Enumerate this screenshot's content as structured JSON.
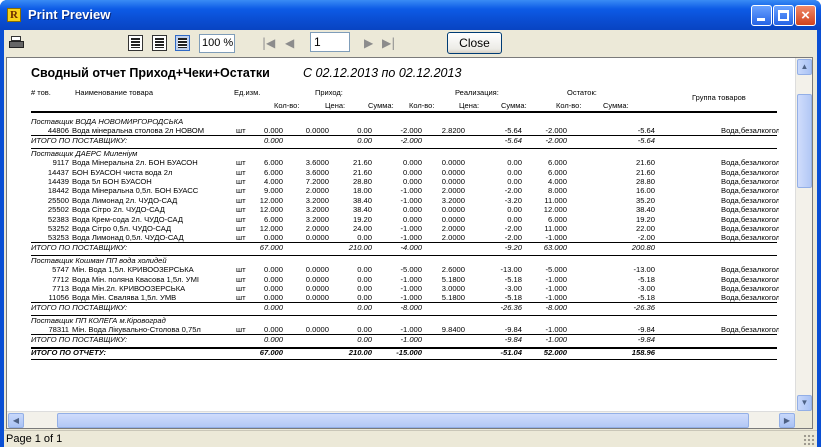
{
  "window": {
    "title": "Print Preview",
    "icon_letter": "R"
  },
  "toolbar": {
    "zoom": "100 %",
    "page": "1",
    "close_label": "Close"
  },
  "report": {
    "title": "Сводный отчет Приход+Чеки+Остатки",
    "period": "С 02.12.2013 по 02.12.2013",
    "headers": {
      "num": "# тов.",
      "name": "Наименование товара",
      "unit": "Ед.изм.",
      "income": "Приход:",
      "sales": "Реализация:",
      "rest": "Остаток:",
      "group": "Группа товаров",
      "qty": "Кол-во:",
      "price": "Цена:",
      "sum": "Сумма:"
    },
    "rows": [
      {
        "type": "supplier",
        "label": "Поставщик  ВОДА НОВОМИРГОРОДСЬКА"
      },
      {
        "type": "item",
        "code": "44806",
        "name": "Вода мінеральна столова 2л НОВОМ",
        "unit": "шт",
        "q1": "0.000",
        "p1": "0.0000",
        "s1": "0.00",
        "q2": "-2.000",
        "p2": "2.8200",
        "s2": "-5.64",
        "q3": "-2.000",
        "s3": "-5.64",
        "group": "Вода,безалкогольні напої"
      },
      {
        "type": "total",
        "label": "ИТОГО ПО ПОСТАВЩИКУ:",
        "q1": "0.000",
        "s1": "0.00",
        "q2": "-2.000",
        "s2": "-5.64",
        "q3": "-2.000",
        "s3": "-5.64"
      },
      {
        "type": "supplier",
        "label": "Поставщик  ДАЕРС Миленіум"
      },
      {
        "type": "item",
        "code": "9117",
        "name": "Вода Мінеральна  2л. БОН БУАСОН",
        "unit": "шт",
        "q1": "6.000",
        "p1": "3.6000",
        "s1": "21.60",
        "q2": "0.000",
        "p2": "0.0000",
        "s2": "0.00",
        "q3": "6.000",
        "s3": "21.60",
        "group": "Вода,безалкогольні напої"
      },
      {
        "type": "item",
        "code": "14437",
        "name": "БОН БУАСОН чиста вода 2л",
        "unit": "шт",
        "q1": "6.000",
        "p1": "3.6000",
        "s1": "21.60",
        "q2": "0.000",
        "p2": "0.0000",
        "s2": "0.00",
        "q3": "6.000",
        "s3": "21.60",
        "group": "Вода,безалкогольні напої"
      },
      {
        "type": "item",
        "code": "14439",
        "name": "Вода 5л БОН БУАСОН",
        "unit": "шт",
        "q1": "4.000",
        "p1": "7.2000",
        "s1": "28.80",
        "q2": "0.000",
        "p2": "0.0000",
        "s2": "0.00",
        "q3": "4.000",
        "s3": "28.80",
        "group": "Вода,безалкогольні напої"
      },
      {
        "type": "item",
        "code": "18442",
        "name": "Вода Мінеральна 0,5л. БОН БУАСС",
        "unit": "шт",
        "q1": "9.000",
        "p1": "2.0000",
        "s1": "18.00",
        "q2": "-1.000",
        "p2": "2.0000",
        "s2": "-2.00",
        "q3": "8.000",
        "s3": "16.00",
        "group": "Вода,безалкогольні напої"
      },
      {
        "type": "item",
        "code": "25500",
        "name": "Вода Лимонад 2л. ЧУДО-САД",
        "unit": "шт",
        "q1": "12.000",
        "p1": "3.2000",
        "s1": "38.40",
        "q2": "-1.000",
        "p2": "3.2000",
        "s2": "-3.20",
        "q3": "11.000",
        "s3": "35.20",
        "group": "Вода,безалкогольні напої"
      },
      {
        "type": "item",
        "code": "25502",
        "name": "Вода Сітро 2л. ЧУДО-САД",
        "unit": "шт",
        "q1": "12.000",
        "p1": "3.2000",
        "s1": "38.40",
        "q2": "0.000",
        "p2": "0.0000",
        "s2": "0.00",
        "q3": "12.000",
        "s3": "38.40",
        "group": "Вода,безалкогольні напої"
      },
      {
        "type": "item",
        "code": "52383",
        "name": "Вода Крем-сода 2л. ЧУДО-САД",
        "unit": "шт",
        "q1": "6.000",
        "p1": "3.2000",
        "s1": "19.20",
        "q2": "0.000",
        "p2": "0.0000",
        "s2": "0.00",
        "q3": "6.000",
        "s3": "19.20",
        "group": "Вода,безалкогольні напої"
      },
      {
        "type": "item",
        "code": "53252",
        "name": "Вода Сітро 0,5л. ЧУДО-САД",
        "unit": "шт",
        "q1": "12.000",
        "p1": "2.0000",
        "s1": "24.00",
        "q2": "-1.000",
        "p2": "2.0000",
        "s2": "-2.00",
        "q3": "11.000",
        "s3": "22.00",
        "group": "Вода,безалкогольні напої"
      },
      {
        "type": "item",
        "code": "53253",
        "name": "Вода Лимонад 0,5л. ЧУДО-САД",
        "unit": "шт",
        "q1": "0.000",
        "p1": "0.0000",
        "s1": "0.00",
        "q2": "-1.000",
        "p2": "2.0000",
        "s2": "-2.00",
        "q3": "-1.000",
        "s3": "-2.00",
        "group": "Вода,безалкогольні напої"
      },
      {
        "type": "total",
        "label": "ИТОГО ПО ПОСТАВЩИКУ:",
        "q1": "67.000",
        "s1": "210.00",
        "q2": "-4.000",
        "s2": "-9.20",
        "q3": "63.000",
        "s3": "200.80"
      },
      {
        "type": "supplier",
        "label": "Поставщик  Кошман ПП вода холидей"
      },
      {
        "type": "item",
        "code": "5747",
        "name": "Мін. Вода 1,5л. КРИВООЗЕРСЬКА",
        "unit": "шт",
        "q1": "0.000",
        "p1": "0.0000",
        "s1": "0.00",
        "q2": "-5.000",
        "p2": "2.6000",
        "s2": "-13.00",
        "q3": "-5.000",
        "s3": "-13.00",
        "group": "Вода,безалкогольні напої"
      },
      {
        "type": "item",
        "code": "7712",
        "name": "Вода Мін. поляна Квасова 1,5л. УМІ",
        "unit": "шт",
        "q1": "0.000",
        "p1": "0.0000",
        "s1": "0.00",
        "q2": "-1.000",
        "p2": "5.1800",
        "s2": "-5.18",
        "q3": "-1.000",
        "s3": "-5.18",
        "group": "Вода,безалкогольні напої"
      },
      {
        "type": "item",
        "code": "7713",
        "name": "Вода Мін.2л. КРИВООЗЕРСЬКА",
        "unit": "шт",
        "q1": "0.000",
        "p1": "0.0000",
        "s1": "0.00",
        "q2": "-1.000",
        "p2": "3.0000",
        "s2": "-3.00",
        "q3": "-1.000",
        "s3": "-3.00",
        "group": "Вода,безалкогольні напої"
      },
      {
        "type": "item",
        "code": "11056",
        "name": "Вода Мін. Свалява 1,5л. УМВ",
        "unit": "шт",
        "q1": "0.000",
        "p1": "0.0000",
        "s1": "0.00",
        "q2": "-1.000",
        "p2": "5.1800",
        "s2": "-5.18",
        "q3": "-1.000",
        "s3": "-5.18",
        "group": "Вода,безалкогольні напої"
      },
      {
        "type": "total",
        "label": "ИТОГО ПО ПОСТАВЩИКУ:",
        "q1": "0.000",
        "s1": "0.00",
        "q2": "-8.000",
        "s2": "-26.36",
        "q3": "-8.000",
        "s3": "-26.36"
      },
      {
        "type": "supplier",
        "label": "Поставщик  ПП КОЛЕГА м.Кіровоград"
      },
      {
        "type": "item",
        "code": "78311",
        "name": "Мін. Вода Лікувально-Столова 0,75л",
        "unit": "шт",
        "q1": "0.000",
        "p1": "0.0000",
        "s1": "0.00",
        "q2": "-1.000",
        "p2": "9.8400",
        "s2": "-9.84",
        "q3": "-1.000",
        "s3": "-9.84",
        "group": "Вода,безалкогольні напої"
      },
      {
        "type": "total",
        "label": "ИТОГО ПО ПОСТАВЩИКУ:",
        "q1": "0.000",
        "s1": "0.00",
        "q2": "-1.000",
        "s2": "-9.84",
        "q3": "-1.000",
        "s3": "-9.84"
      },
      {
        "type": "grand",
        "label": "ИТОГО ПО ОТЧЕТУ:",
        "q1": "67.000",
        "s1": "210.00",
        "q2": "-15.000",
        "s2": "-51.04",
        "q3": "52.000",
        "s3": "158.96"
      }
    ]
  },
  "status": {
    "text": "Page 1 of 1"
  },
  "icons": {
    "app": "app-icon",
    "minimize": "minimize-icon",
    "maximize": "maximize-icon",
    "close": "close-icon",
    "print": "printer-icon",
    "one_page": "single-page-icon",
    "two_page": "page-width-icon",
    "multi_page": "whole-page-icon",
    "first": "first-page-icon",
    "prev": "previous-page-icon",
    "next": "next-page-icon",
    "last": "last-page-icon",
    "close_glyph": "×",
    "first_glyph": "|◀",
    "prev_glyph": "◀",
    "next_glyph": "▶",
    "last_glyph": "▶|",
    "up_glyph": "▲",
    "down_glyph": "▼",
    "left_glyph": "◀",
    "right_glyph": "▶"
  }
}
